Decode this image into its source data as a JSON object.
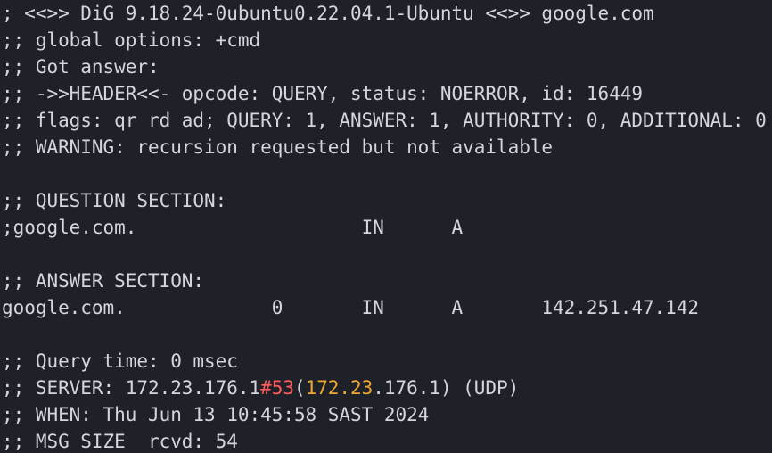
{
  "terminal": {
    "lines": [
      "; <<>> DiG 9.18.24-0ubuntu0.22.04.1-Ubuntu <<>> google.com",
      ";; global options: +cmd",
      ";; Got answer:",
      ";; ->>HEADER<<- opcode: QUERY, status: NOERROR, id: 16449",
      ";; flags: qr rd ad; QUERY: 1, ANSWER: 1, AUTHORITY: 0, ADDITIONAL: 0",
      ";; WARNING: recursion requested but not available",
      "",
      ";; QUESTION SECTION:",
      ";google.com.                    IN      A",
      "",
      ";; ANSWER SECTION:",
      "google.com.             0       IN      A       142.251.47.142",
      "",
      ";; Query time: 0 msec"
    ],
    "server_line": {
      "prefix": ";; SERVER: 172.23.176.1",
      "hash_port": "#53",
      "paren_open": "(",
      "ip_highlight": "172.23",
      "rest": ".176.1) (UDP)"
    },
    "lines_after": [
      ";; WHEN: Thu Jun 13 10:45:58 SAST 2024",
      ";; MSG SIZE  rcvd: 54"
    ],
    "colors": {
      "background": "#1f2129",
      "text": "#d4d6dc",
      "hash_port": "#ff5c5c",
      "ip_highlight": "#f0a830"
    }
  }
}
